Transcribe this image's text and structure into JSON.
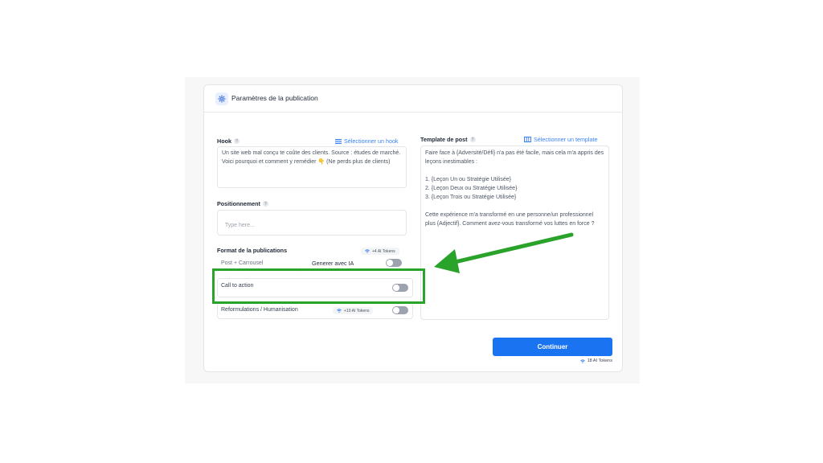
{
  "header": {
    "title": "Paramètres de la publication"
  },
  "hook": {
    "label": "Hook",
    "select_link": "Sélectionner un hook",
    "value": "Un site web mal conçu te coûte des clients. Source : études de marché. Voici pourquoi et comment y remédier 👇 (Ne perds plus de clients)"
  },
  "positionnement": {
    "label": "Positionnement",
    "placeholder": "Type here..."
  },
  "format": {
    "label": "Format de la publications",
    "tokens_badge": "+4 AI Tokens",
    "select_value": "Post + Carrousel",
    "ia_label": "Generer avec IA"
  },
  "call_to_action": {
    "label": "Call to action"
  },
  "reformulations": {
    "label": "Reformulations / Humanisation",
    "tokens_badge": "+10 AI Tokens"
  },
  "template": {
    "label": "Template de post",
    "select_link": "Sélectionner un template",
    "value": "Faire face à {Adversité/Défi} n'a pas été facile, mais cela m'a appris des leçons inestimables :\n\n1. {Leçon Un ou Stratégie Utilisée}\n2. {Leçon Deux ou Stratégie Utilisée}\n3. {Leçon Trois ou Stratégie Utilisée}\n\nCette expérience m'a transformé en une personne/un professionnel plus {Adjectif}. Comment avez-vous transformé vos luttes en force ?"
  },
  "actions": {
    "continue_label": "Continuer",
    "tokens_total": "18 AI Tokens"
  },
  "icons": {
    "settings": "gear-icon",
    "hook_link": "list-icon",
    "template_link": "columns-icon",
    "tokens": "wifi-icon"
  },
  "colors": {
    "accent": "#1a73f0",
    "highlight": "#2aa32a",
    "arrow": "#2aa32a",
    "toggle_off": "#9ca3af"
  },
  "toggles": {
    "generer_ia": false,
    "call_to_action": false,
    "reformulations": false
  }
}
